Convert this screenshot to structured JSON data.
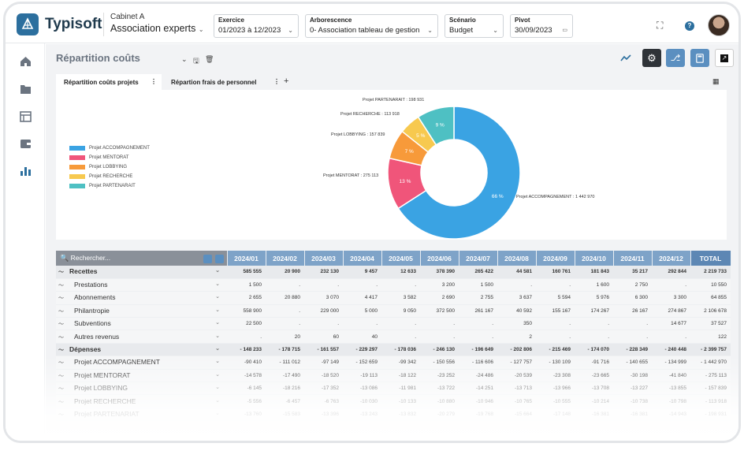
{
  "header": {
    "brand": "Typisoft",
    "cabinet_line1": "Cabinet A",
    "cabinet_line2": "Association experts",
    "fields": [
      {
        "label": "Exercice",
        "value": "01/2023 à 12/2023"
      },
      {
        "label": "Arborescence",
        "value": "0- Association tableau de gestion"
      },
      {
        "label": "Scénario",
        "value": "Budget"
      },
      {
        "label": "Pivot",
        "value": "30/09/2023"
      }
    ],
    "help": "?"
  },
  "sidebar": {
    "icons": [
      "home-icon",
      "folder-icon",
      "table-icon",
      "wallet-icon",
      "bar-chart-icon"
    ]
  },
  "page": {
    "title": "Répartition coûts"
  },
  "tabs": [
    {
      "label": "Répartition coûts projets"
    },
    {
      "label": "Répartion frais de personnel"
    }
  ],
  "chart_data": {
    "type": "pie",
    "donut": true,
    "legend_position": "left",
    "title": "",
    "categories": [
      "Projet ACCOMPAGNEMENT",
      "Projet MENTORAT",
      "Projet LOBBYING",
      "Projet RECHERCHE",
      "Projet PARTENARIAT"
    ],
    "values": [
      1442970,
      275113,
      157839,
      113918,
      198931
    ],
    "percent_labels": [
      "66 %",
      "13 %",
      "7 %",
      "5 %",
      "9 %"
    ],
    "slice_labels": [
      "Projet ACCOMPAGNEMENT : 1 442 970",
      "Projet MENTORAT : 275 113",
      "Projet LOBBYING : 157 839",
      "Projet RECHERCHE : 113 918",
      "Projet PARTENARAIT : 198 931"
    ],
    "legend_labels": [
      "Projet ACCOMPAGNEMENT",
      "Projet MENTORAT",
      "Projet LOBBYING",
      "Projet RECHERCHE",
      "Projet PARTENARAIT"
    ],
    "colors": [
      "#3aa3e3",
      "#f0557a",
      "#f79a3a",
      "#f7c94f",
      "#4ec0c3"
    ]
  },
  "table": {
    "search_placeholder": "Rechercher...",
    "columns": [
      "2024/01",
      "2024/02",
      "2024/03",
      "2024/04",
      "2024/05",
      "2024/06",
      "2024/07",
      "2024/08",
      "2024/09",
      "2024/10",
      "2024/11",
      "2024/12",
      "TOTAL"
    ],
    "rows": [
      {
        "label": "Recettes",
        "kind": "group",
        "values": [
          "585 555",
          "20 900",
          "232 130",
          "9 457",
          "12 633",
          "378 390",
          "265 422",
          "44 581",
          "160 761",
          "181 843",
          "35 217",
          "292 844",
          "2 219 733"
        ]
      },
      {
        "label": "Prestations",
        "kind": "sub",
        "values": [
          "1 500",
          ".",
          ".",
          ".",
          ".",
          "3 200",
          "1 500",
          ".",
          ".",
          "1 600",
          "2 750",
          ".",
          "10 550"
        ]
      },
      {
        "label": "Abonnements",
        "kind": "sub",
        "values": [
          "2 655",
          "20 880",
          "3 070",
          "4 417",
          "3 582",
          "2 690",
          "2 755",
          "3 637",
          "5 594",
          "5 976",
          "6 300",
          "3 300",
          "64 855"
        ]
      },
      {
        "label": "Philantropie",
        "kind": "sub",
        "values": [
          "558 900",
          ".",
          "229 000",
          "5 000",
          "9 050",
          "372 500",
          "261 167",
          "40 592",
          "155 167",
          "174 267",
          "26 167",
          "274 867",
          "2 106 678"
        ]
      },
      {
        "label": "Subventions",
        "kind": "sub",
        "values": [
          "22 500",
          ".",
          ".",
          ".",
          ".",
          ".",
          ".",
          "350",
          ".",
          ".",
          ".",
          "14 677",
          "37 527"
        ]
      },
      {
        "label": "Autres revenus",
        "kind": "sub",
        "values": [
          ".",
          "20",
          "60",
          "40",
          ".",
          ".",
          ".",
          "2",
          ".",
          ".",
          ".",
          ".",
          "122"
        ]
      },
      {
        "label": "Dépenses",
        "kind": "group",
        "values": [
          "- 148 233",
          "- 178 715",
          "- 161 557",
          "- 229 297",
          "- 178 036",
          "- 246 130",
          "- 196 649",
          "- 202 806",
          "- 215 469",
          "- 174 070",
          "- 228 349",
          "- 240 448",
          "- 2 399 757"
        ]
      },
      {
        "label": "Projet ACCOMPAGNEMENT",
        "kind": "sub",
        "values": [
          "-90 410",
          "- 111 012",
          "-97 149",
          "- 152 659",
          "-99 342",
          "- 150 556",
          "- 116 606",
          "- 127 757",
          "- 130 109",
          "-91 716",
          "- 140 655",
          "- 134 999",
          "- 1 442 970"
        ]
      },
      {
        "label": "Projet MENTORAT",
        "kind": "sub",
        "values": [
          "-14 578",
          "-17 490",
          "-18 520",
          "-19 113",
          "-18 122",
          "-23 252",
          "-24 486",
          "-20 539",
          "-23 308",
          "-23 665",
          "-30 198",
          "-41 840",
          "- 275 113"
        ]
      },
      {
        "label": "Projet LOBBYING",
        "kind": "sub",
        "values": [
          "-6 145",
          "-18 216",
          "-17 352",
          "-13 086",
          "-11 981",
          "-13 722",
          "-14 251",
          "-13 713",
          "-13 966",
          "-13 708",
          "-13 227",
          "-13 855",
          "- 157 839"
        ]
      },
      {
        "label": "Projet RECHERCHE",
        "kind": "sub",
        "values": [
          "-5 556",
          "-6 457",
          "-6 763",
          "-10 030",
          "-10 133",
          "-10 880",
          "-10 946",
          "-10 765",
          "-10 555",
          "-10 214",
          "-10 738",
          "-10 798",
          "- 113 918"
        ]
      },
      {
        "label": "Projet PARTENARIAT",
        "kind": "sub",
        "values": [
          "-13 760",
          "-15 583",
          "-13 396",
          "-13 243",
          "-13 832",
          "-20 279",
          "-19 768",
          "-15 664",
          "-17 148",
          "-16 381",
          "-16 381",
          "-14 943",
          "- 198 931"
        ]
      }
    ]
  }
}
